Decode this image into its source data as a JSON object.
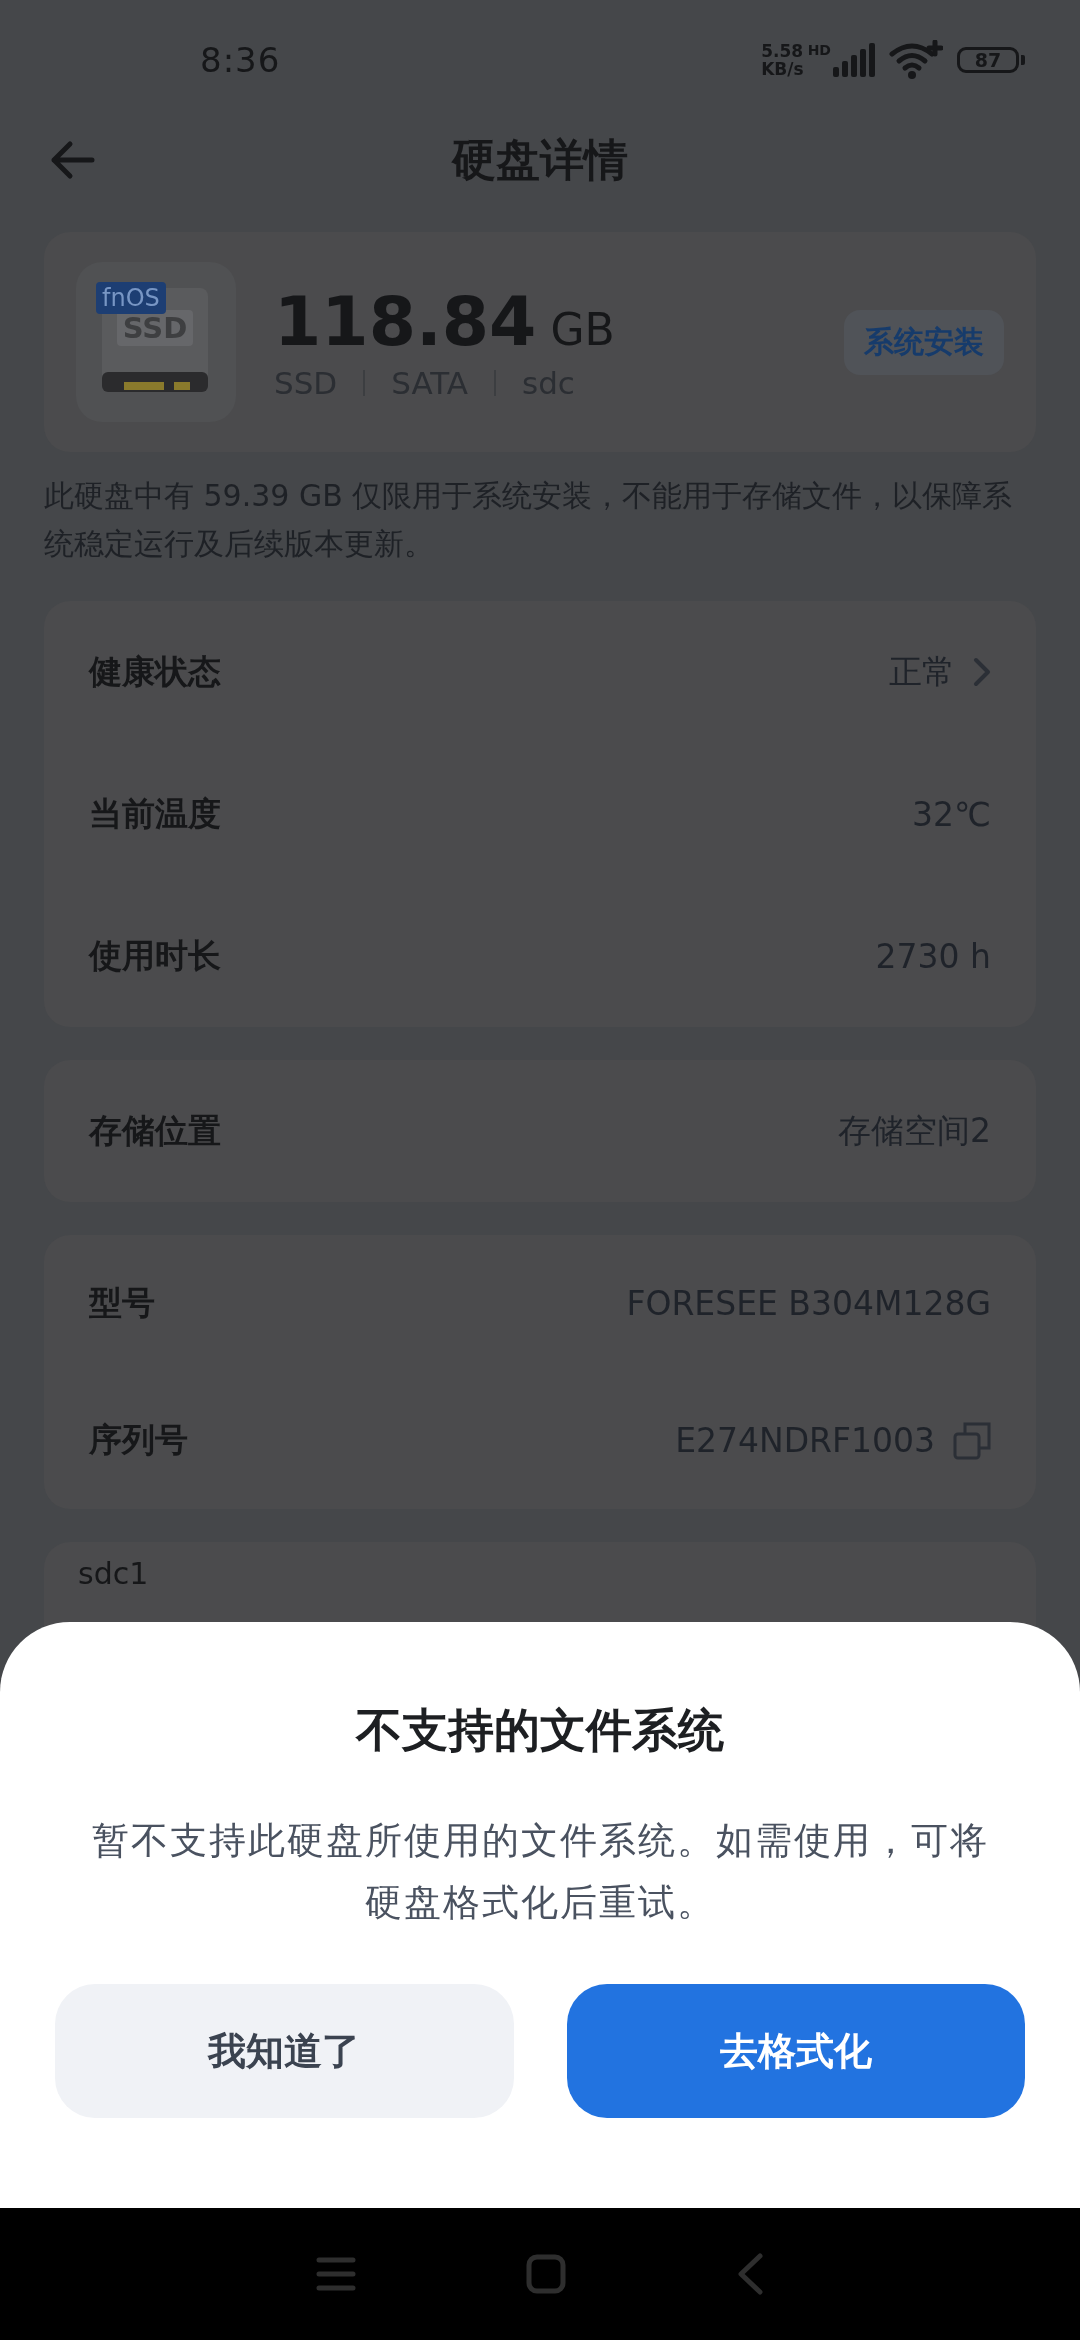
{
  "status_bar": {
    "time": "8:36",
    "net_speed": [
      "5.58",
      "KB/s"
    ],
    "network": "HD",
    "battery": "87"
  },
  "header": {
    "title": "硬盘详情"
  },
  "disk": {
    "icon_badge": "fnOS",
    "icon_label": "SSD",
    "size": "118.84",
    "unit": "GB",
    "specs": [
      "SSD",
      "SATA",
      "sdc"
    ],
    "tag": "系统安装"
  },
  "note": "此硬盘中有 59.39 GB 仅限用于系统安装，不能用于存储文件，以保障系统稳定运行及后续版本更新。",
  "groups": [
    {
      "rows": [
        {
          "label": "健康状态",
          "value": "正常",
          "kind": "link"
        },
        {
          "label": "当前温度",
          "value": "32℃",
          "kind": "plain"
        },
        {
          "label": "使用时长",
          "value": "2730 h",
          "kind": "plain"
        }
      ]
    },
    {
      "rows": [
        {
          "label": "存储位置",
          "value": "存储空间2",
          "kind": "plain"
        }
      ]
    },
    {
      "rows": [
        {
          "label": "型号",
          "value": "FORESEE B304M128G",
          "kind": "plain"
        },
        {
          "label": "序列号",
          "value": "E274NDRF1003",
          "kind": "copy"
        }
      ]
    }
  ],
  "partition": {
    "name": "sdc1"
  },
  "dialog": {
    "title": "不支持的文件系统",
    "message": "暂不支持此硬盘所使用的文件系统。如需使用，可将硬盘格式化后重试。",
    "buttons": [
      {
        "label": "我知道了",
        "kind": "secondary"
      },
      {
        "label": "去格式化",
        "kind": "primary"
      }
    ]
  }
}
